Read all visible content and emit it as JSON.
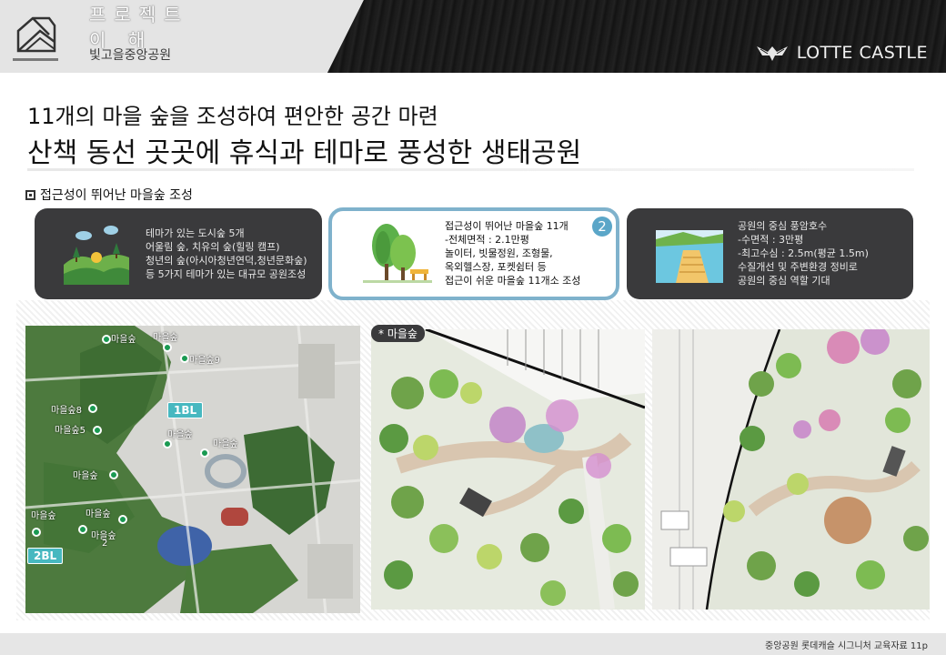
{
  "header": {
    "title": "프로젝트 이 해",
    "subtitle": "빛고을중앙공원",
    "brand": "LOTTE CASTLE"
  },
  "headings": {
    "line1": "11개의 마을 숲을 조성하여 편안한 공간 마련",
    "line2": "산책 동선 곳곳에 휴식과 테마로 풍성한 생태공원"
  },
  "section_title": "접근성이 뛰어난 마을숲 조성",
  "cards": [
    {
      "lines": [
        "테마가 있는 도시숲 5개",
        "어울림 숲, 치유의 숲(힐링 캠프)",
        "청년의 숲(아시아청년연덕,청년문화숲)",
        "등 5가지 테마가 있는 대규모 공원조성"
      ],
      "icon": "hills-landscape-icon"
    },
    {
      "lines": [
        "접근성이 뛰어난 마을숲 11개",
        "-전체면적 : 2.1만평",
        "놀이터, 빗물정원, 조형물,",
        "옥외헬스장, 포켓쉼터 등",
        "접근이 쉬운 마을숲 11개소 조성"
      ],
      "badge": "2",
      "icon": "trees-bench-icon"
    },
    {
      "lines": [
        "공원의 중심 풍암호수",
        "-수면적 : 3만평",
        "-최고수심 : 2.5m(평균 1.5m)",
        "수질개선 및 주변환경 정비로",
        "공원의 중심 역할 기대"
      ],
      "icon": "lake-pier-icon"
    }
  ],
  "map": {
    "labels": [
      "마을숲",
      "마을숲",
      "마을숲9",
      "마을숲8",
      "마을숲5",
      "마을숲",
      "마을숲",
      "마을숲",
      "마을숲",
      "마을숲",
      "마을숲",
      "2"
    ],
    "tags": [
      "1BL",
      "2BL"
    ]
  },
  "plan_tag": "* 마을숲",
  "footer": "중앙공원 롯데캐슬 시그니처 교육자료 11p",
  "colors": {
    "card_dark": "#3a3a3c",
    "card_highlight_border": "#7fb2cc",
    "badge": "#5ba6c8",
    "tag_teal": "#47b8c0"
  }
}
